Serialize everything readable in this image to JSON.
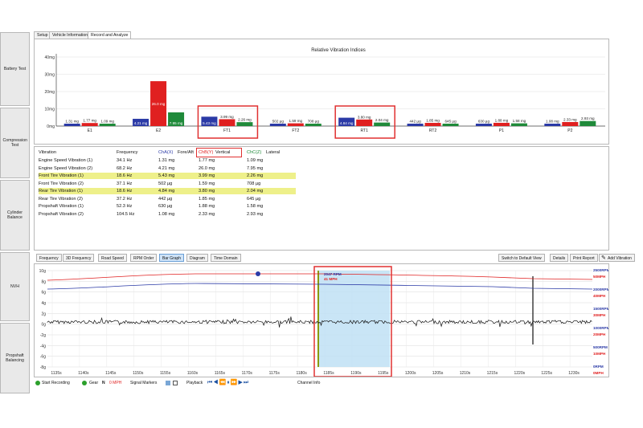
{
  "sidebar": {
    "items": [
      "Battery Test",
      "Compression Test",
      "Cylinder Balance",
      "NVH",
      "Propshaft Balancing"
    ]
  },
  "tabs": [
    "Setup",
    "Vehicle Information",
    "Record and Analyze"
  ],
  "bar_chart": {
    "title": "Relative Vibration Indices",
    "y_ticks": [
      "0mg",
      "10mg",
      "20mg",
      "30mg",
      "40mg"
    ],
    "groups": [
      {
        "name": "E1",
        "labels": [
          "1.31 mg",
          "1.77 mg",
          "1.09 mg"
        ]
      },
      {
        "name": "E2",
        "labels": [
          "4.21 mg",
          "26.0 mg",
          "7.95 mg"
        ]
      },
      {
        "name": "FT1",
        "labels": [
          "5.43 mg",
          "3.99 mg",
          "2.26 mg"
        ]
      },
      {
        "name": "FT2",
        "labels": [
          "502 µg",
          "1.59 mg",
          "708 µg"
        ]
      },
      {
        "name": "RT1",
        "labels": [
          "4.84 mg",
          "3.80 mg",
          "2.04 mg"
        ]
      },
      {
        "name": "RT2",
        "labels": [
          "442 µg",
          "1.85 mg",
          "645 µg"
        ]
      },
      {
        "name": "P1",
        "labels": [
          "630 µg",
          "1.88 mg",
          "1.58 mg"
        ]
      },
      {
        "name": "P2",
        "labels": [
          "1.08 mg",
          "2.33 mg",
          "2.93 mg"
        ]
      }
    ]
  },
  "chart_data": {
    "type": "bar",
    "title": "Relative Vibration Indices",
    "categories": [
      "E1",
      "E2",
      "FT1",
      "FT2",
      "RT1",
      "RT2",
      "P1",
      "P2"
    ],
    "ylabel": "",
    "ylim": [
      0,
      40
    ],
    "series": [
      {
        "name": "ChA(X) Fore/Aft",
        "color": "#2b3aa6",
        "values": [
          1.31,
          4.21,
          5.43,
          0.502,
          4.84,
          0.442,
          0.63,
          1.08
        ]
      },
      {
        "name": "ChB(Y) Vertical",
        "color": "#e02020",
        "values": [
          1.77,
          26.0,
          3.99,
          1.59,
          3.8,
          1.85,
          1.88,
          2.33
        ]
      },
      {
        "name": "ChC(Z) Lateral",
        "color": "#1f8a3a",
        "values": [
          1.09,
          7.95,
          2.26,
          0.708,
          2.04,
          0.645,
          1.58,
          2.93
        ]
      }
    ]
  },
  "table": {
    "headers": {
      "vibration": "Vibration",
      "frequency": "Frequency",
      "cha": "ChA(X)",
      "cha_dir": "Fore/Aft",
      "chb": "ChB(Y)",
      "chb_dir": "Vertical",
      "chc": "ChC(Z)",
      "chc_dir": "Lateral"
    },
    "rows": [
      {
        "name": "Engine Speed Vibration (1)",
        "freq": "34.1 Hz",
        "a": "1.31 mg",
        "b": "1.77 mg",
        "c": "1.09 mg"
      },
      {
        "name": "Engine Speed Vibration (2)",
        "freq": "68.2 Hz",
        "a": "4.21 mg",
        "b": "26.0 mg",
        "c": "7.95 mg"
      },
      {
        "name": "Front Tire Vibration (1)",
        "freq": "18.6 Hz",
        "a": "5.43 mg",
        "b": "3.99 mg",
        "c": "2.26 mg"
      },
      {
        "name": "Front Tire Vibration (2)",
        "freq": "37.1 Hz",
        "a": "502 µg",
        "b": "1.59 mg",
        "c": "708 µg"
      },
      {
        "name": "Rear Tire Vibration (1)",
        "freq": "18.6 Hz",
        "a": "4.84 mg",
        "b": "3.80 mg",
        "c": "2.04 mg"
      },
      {
        "name": "Rear Tire Vibration (2)",
        "freq": "37.2 Hz",
        "a": "442 µg",
        "b": "1.85 mg",
        "c": "645 µg"
      },
      {
        "name": "Propshaft Vibration (1)",
        "freq": "52.3 Hz",
        "a": "630 µg",
        "b": "1.88 mg",
        "c": "1.58 mg"
      },
      {
        "name": "Propshaft Vibration (2)",
        "freq": "104.5 Hz",
        "a": "1.08 mg",
        "b": "2.33 mg",
        "c": "2.93 mg"
      }
    ]
  },
  "toolbar": {
    "views": [
      "Frequency",
      "3D Frequency",
      "Road Speed",
      "RPM Order",
      "Bar Graph",
      "Diagram",
      "Time Domain"
    ],
    "actions": [
      "Switch to Default View",
      "Details",
      "Print Report",
      "Add Vibration"
    ]
  },
  "time_chart": {
    "left_ticks": [
      "10g",
      "8g",
      "6g",
      "4g",
      "2g",
      "0g",
      "-2g",
      "-4g",
      "-6g",
      "-8g"
    ],
    "right_rpm": [
      "2500RPM",
      "2000RPM",
      "1500RPM",
      "1000RPM",
      "500RPM",
      "0RPM"
    ],
    "right_mph": [
      "50MPH",
      "40MPH",
      "30MPH",
      "20MPH",
      "10MPH",
      "0MPH"
    ],
    "x_ticks": [
      "1135s",
      "1140s",
      "1145s",
      "1150s",
      "1155s",
      "1160s",
      "1165s",
      "1170s",
      "1175s",
      "1180s",
      "1185s",
      "1190s",
      "1195s",
      "1200s",
      "1205s",
      "1210s",
      "1215s",
      "1220s",
      "1225s",
      "1230s"
    ],
    "cursor_rpm": "2047 RPM",
    "cursor_mph": "41 MPH"
  },
  "status_bar": {
    "start_recording": "Start Recording",
    "gear_label": "Gear",
    "gear_value": "N",
    "speed": "0 MPH",
    "signal_markers": "Signal Markers",
    "playback": "Playback",
    "channel_info": "Channel Info"
  },
  "colors": {
    "cha": "#2b3aa6",
    "chb": "#e02020",
    "chc": "#1f8a3a",
    "highlight": "#eef08a",
    "annotation": "#e03030",
    "selection": "#bfe0f5"
  }
}
